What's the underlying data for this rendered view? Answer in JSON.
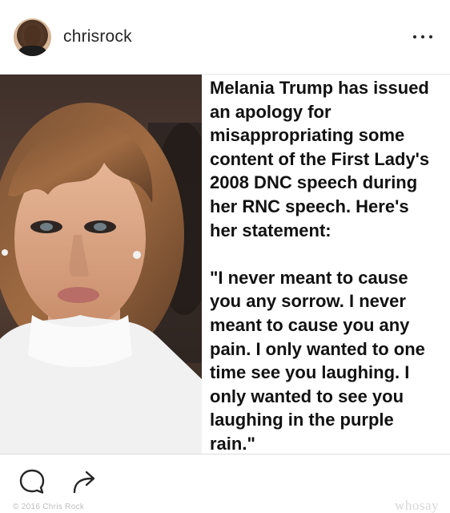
{
  "header": {
    "username": "chrisrock",
    "avatar_icon": "profile-avatar",
    "more_icon": "ellipsis-icon"
  },
  "post": {
    "quote_text": "Melania Trump has issued\nan apology for\nmisappropriating some\ncontent of the First Lady's\n2008 DNC speech during\nher RNC speech. Here's\nher statement:\n\n\"I never meant to cause\nyou any sorrow. I never\nmeant to cause you any\npain. I only wanted to one\ntime see you laughing. I\nonly wanted to see you\nlaughing in the purple\nrain.\""
  },
  "footer": {
    "comment_icon": "comment-icon",
    "share_icon": "share-icon",
    "watermark_left": "© 2016 Chris Rock",
    "watermark_right": "whosay"
  },
  "colors": {
    "text": "#262626",
    "border": "#e6e6e6",
    "background": "#ffffff"
  }
}
